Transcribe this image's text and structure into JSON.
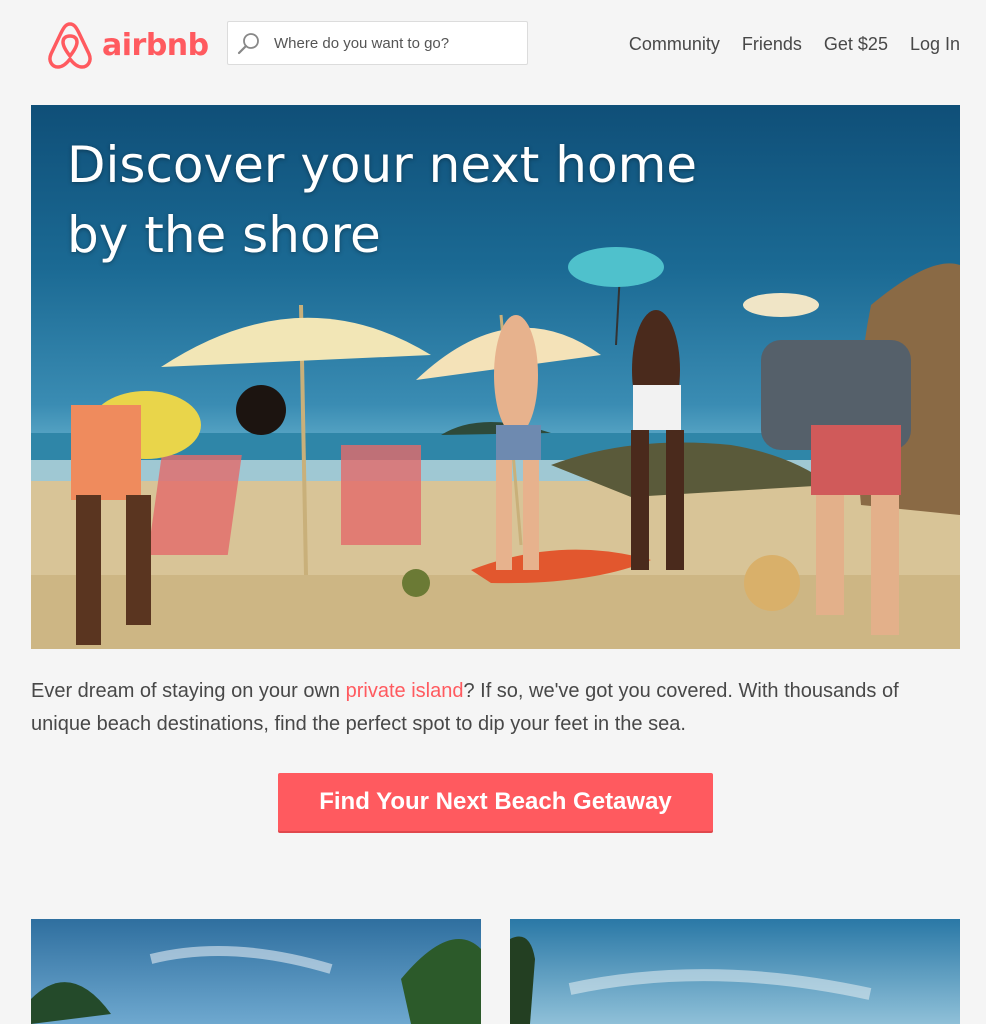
{
  "header": {
    "logo_text": "airbnb",
    "search": {
      "placeholder": "Where do you want to go?",
      "value": ""
    },
    "nav": [
      {
        "label": "Community"
      },
      {
        "label": "Friends"
      },
      {
        "label": "Get $25"
      },
      {
        "label": "Log In"
      }
    ]
  },
  "hero": {
    "title_line1": "Discover your next home",
    "title_line2": "by the shore"
  },
  "intro": {
    "text_before": "Ever dream of staying on your own ",
    "link_text": "private island",
    "text_after": "? If so, we've got you covered. With thousands of unique beach destinations, find the perfect spot to dip your feet in the sea."
  },
  "cta": {
    "label": "Find Your Next Beach Getaway"
  },
  "colors": {
    "brand": "#ff5a5f",
    "text": "#484848",
    "background": "#f5f5f5"
  },
  "icons": {
    "logo": "airbnb-belo-icon",
    "search": "search-icon"
  }
}
